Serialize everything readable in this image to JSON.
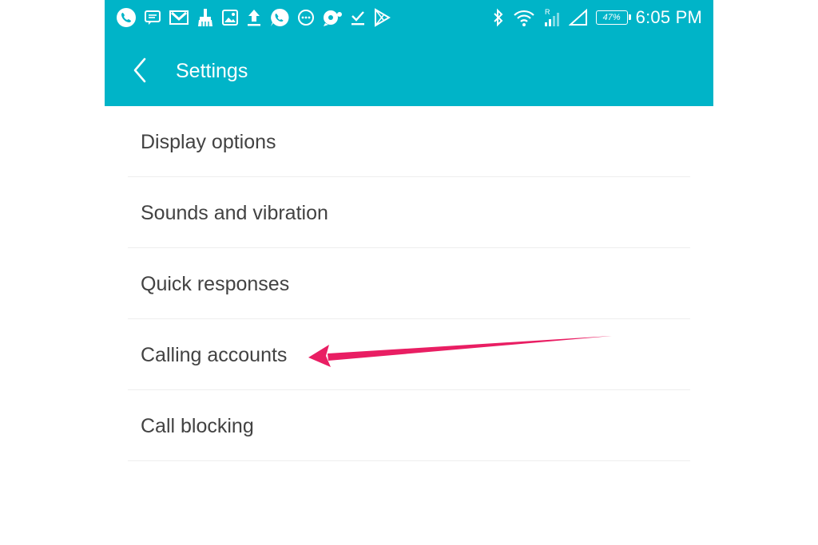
{
  "status_bar": {
    "left_icons": [
      "whatsapp-call-icon",
      "message-icon",
      "gmail-icon",
      "cleaner-icon",
      "gallery-icon",
      "upload-icon",
      "whatsapp-icon",
      "chat-icon",
      "notification-icon",
      "download-done-icon",
      "play-store-icon"
    ],
    "right_icons": [
      "bluetooth-icon",
      "wifi-icon",
      "roaming-signal-icon",
      "cellular-signal-icon",
      "battery-icon"
    ],
    "battery_percent": "47%",
    "time": "6:05 PM"
  },
  "toolbar": {
    "title": "Settings",
    "back_icon": "chevron-left-icon"
  },
  "settings_list": {
    "items": [
      {
        "label": "Display options"
      },
      {
        "label": "Sounds and vibration"
      },
      {
        "label": "Quick responses"
      },
      {
        "label": "Calling accounts"
      },
      {
        "label": "Call blocking"
      }
    ]
  },
  "annotation": {
    "arrow_color": "#e91e63"
  },
  "colors": {
    "app_bar": "#00b4c8",
    "list_text": "#424242",
    "divider": "#eeeeee"
  }
}
